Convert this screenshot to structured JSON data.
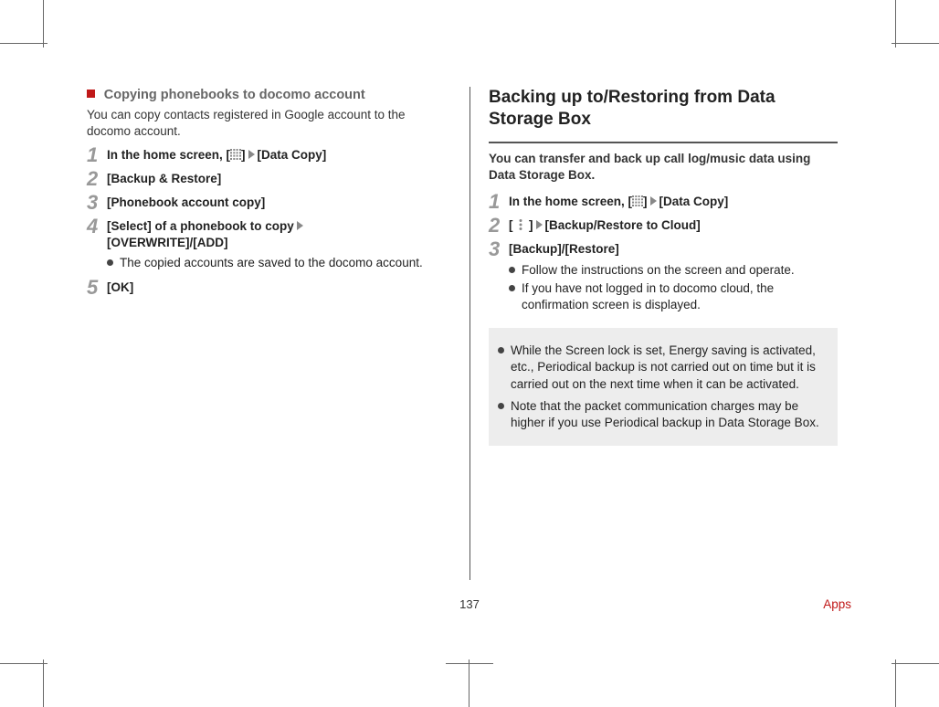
{
  "left": {
    "subhead": "Copying phonebooks to docomo account",
    "intro": "You can copy contacts registered in Google account to the docomo account.",
    "steps": [
      {
        "pre": "In the home screen, [",
        "icon": "grid",
        "post": "[Data Copy]"
      },
      {
        "text": "[Backup & Restore]"
      },
      {
        "text": "[Phonebook account copy]"
      },
      {
        "line1": "[Select] of a phonebook to copy",
        "line2": "[OVERWRITE]/[ADD]",
        "sub": "The copied accounts are saved to the docomo account."
      },
      {
        "text": "[OK]"
      }
    ]
  },
  "right": {
    "title": "Backing up to/Restoring from Data Storage Box",
    "intro": "You can transfer and back up call log/music data using Data Storage Box.",
    "steps": [
      {
        "pre": "In the home screen, [",
        "icon": "grid",
        "post": "[Data Copy]"
      },
      {
        "pre": "[",
        "icon": "kebab",
        "post": "[Backup/Restore to Cloud]",
        "close_before_arrow": true
      },
      {
        "text": "[Backup]/[Restore]",
        "subs": [
          "Follow the instructions on the screen and operate.",
          "If you have not logged in to docomo cloud, the confirmation screen is displayed."
        ]
      }
    ],
    "notes": [
      "While the Screen lock is set, Energy saving is activated, etc., Periodical backup is not carried out on time but it is carried out on the next time when it can be activated.",
      "Note that the packet communication charges may be higher if you use Periodical backup in Data Storage Box."
    ]
  },
  "footer": {
    "page": "137",
    "section": "Apps"
  }
}
